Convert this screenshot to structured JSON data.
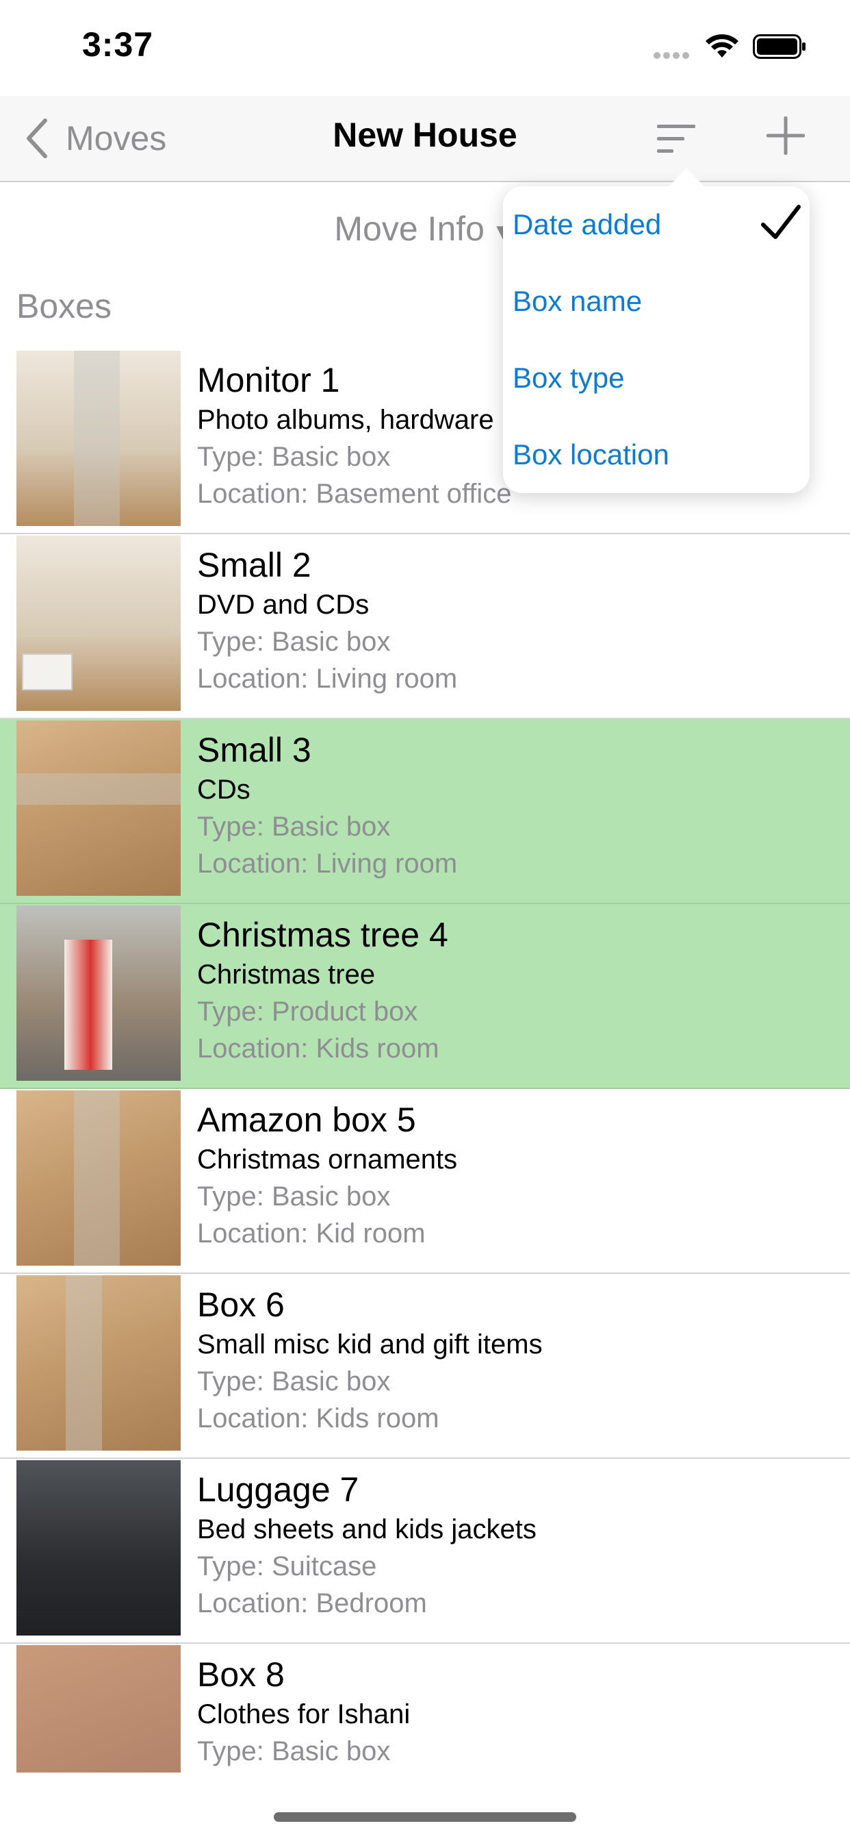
{
  "status_bar": {
    "time": "3:37"
  },
  "nav": {
    "back_label": "Moves",
    "title": "New House"
  },
  "move_info": {
    "label": "Move Info",
    "caret": "▼"
  },
  "section": {
    "header": "Boxes"
  },
  "sort_menu": {
    "options": [
      "Date added",
      "Box name",
      "Box type",
      "Box location"
    ],
    "selected": "Date added"
  },
  "boxes": [
    {
      "name": "Monitor 1",
      "contents": "Photo albums, hardware …",
      "type": "Type: Basic box",
      "location": "Location: Basement office",
      "highlighted": false
    },
    {
      "name": "Small 2",
      "contents": "DVD and CDs",
      "type": "Type: Basic box",
      "location": "Location: Living room",
      "highlighted": false
    },
    {
      "name": "Small 3",
      "contents": "CDs",
      "type": "Type: Basic box",
      "location": "Location: Living room",
      "highlighted": true
    },
    {
      "name": "Christmas tree 4",
      "contents": "Christmas tree",
      "type": "Type: Product box",
      "location": "Location: Kids room",
      "highlighted": true
    },
    {
      "name": "Amazon box 5",
      "contents": "Christmas ornaments",
      "type": "Type: Basic box",
      "location": "Location: Kid room",
      "highlighted": false
    },
    {
      "name": "Box 6",
      "contents": "Small misc kid and gift items",
      "type": "Type: Basic box",
      "location": "Location: Kids room",
      "highlighted": false
    },
    {
      "name": "Luggage 7",
      "contents": "Bed sheets and kids jackets",
      "type": "Type: Suitcase",
      "location": "Location: Bedroom",
      "highlighted": false
    },
    {
      "name": "Box 8",
      "contents": "Clothes for Ishani",
      "type": "Type: Basic box",
      "location": "",
      "highlighted": false
    }
  ],
  "colors": {
    "accent": "#0a7bd6",
    "highlight": "#b2e3b1",
    "secondary_text": "#8e8e93"
  }
}
